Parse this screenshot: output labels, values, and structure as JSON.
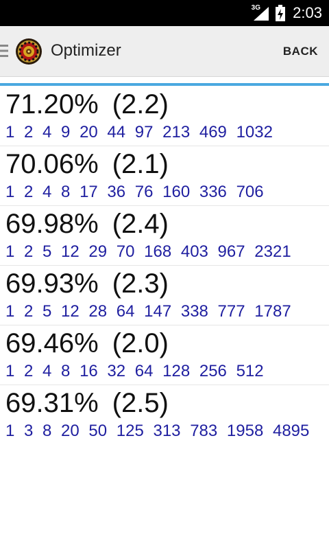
{
  "status_bar": {
    "network": "3G",
    "time": "2:03"
  },
  "action_bar": {
    "title": "Optimizer",
    "back_label": "BACK"
  },
  "results": [
    {
      "percent": "71.20%",
      "factor": "(2.2)",
      "sequence": "1 2 4 9 20 44 97 213 469 1032"
    },
    {
      "percent": "70.06%",
      "factor": "(2.1)",
      "sequence": "1 2 4 8 17 36 76 160 336 706"
    },
    {
      "percent": "69.98%",
      "factor": "(2.4)",
      "sequence": "1 2 5 12 29 70 168 403 967 2321"
    },
    {
      "percent": "69.93%",
      "factor": "(2.3)",
      "sequence": "1 2 5 12 28 64 147 338 777 1787"
    },
    {
      "percent": "69.46%",
      "factor": "(2.0)",
      "sequence": "1 2 4 8 16 32 64 128 256 512"
    },
    {
      "percent": "69.31%",
      "factor": "(2.5)",
      "sequence": "1 3 8 20 50 125 313 783 1958 4895"
    }
  ],
  "colors": {
    "accent": "#4aa8e0",
    "sequence_text": "#1f1fa0"
  }
}
